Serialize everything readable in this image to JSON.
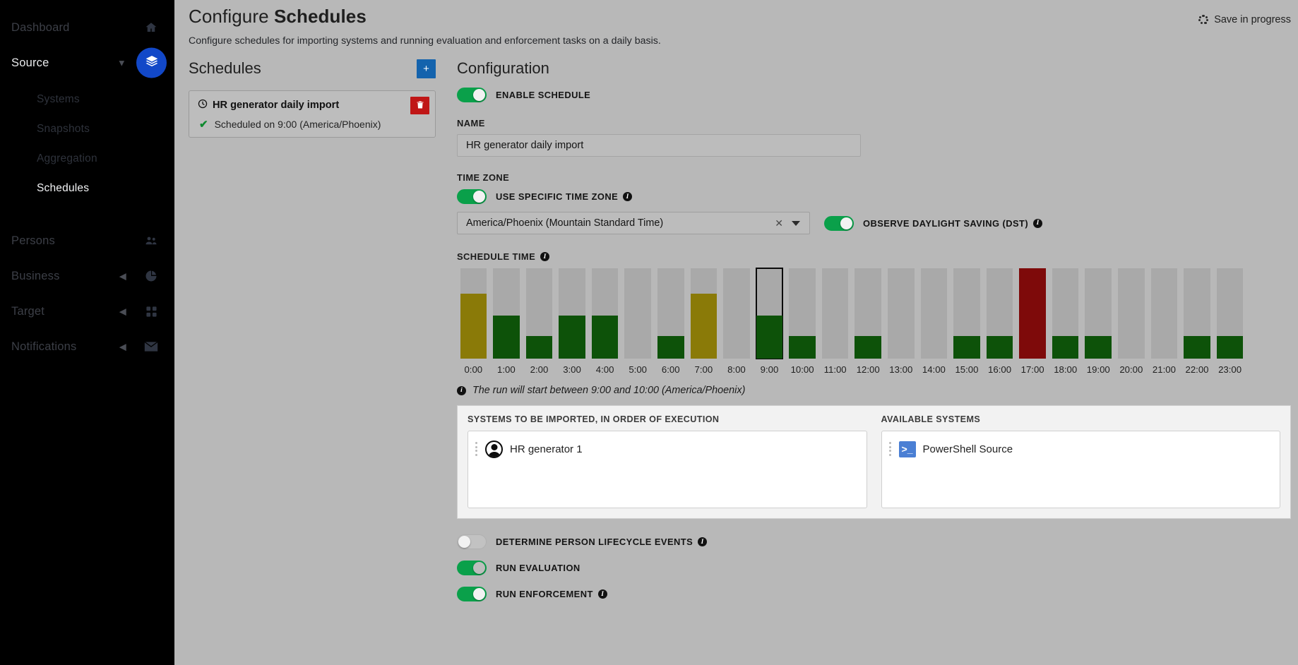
{
  "sidebar": {
    "items": [
      {
        "label": "Dashboard",
        "icon": "home-icon",
        "state": "dim",
        "chevron": false
      },
      {
        "label": "Source",
        "icon": "layers-icon",
        "state": "active",
        "chevron": true,
        "pill": true
      },
      {
        "label": "Persons",
        "icon": "people-icon",
        "state": "dim",
        "chevron": false
      },
      {
        "label": "Business",
        "icon": "pie-icon",
        "state": "dim",
        "chevron": true
      },
      {
        "label": "Target",
        "icon": "grid-icon",
        "state": "dim",
        "chevron": true
      },
      {
        "label": "Notifications",
        "icon": "envelope-icon",
        "state": "dim",
        "chevron": true
      }
    ],
    "subitems": [
      {
        "label": "Systems",
        "selected": false
      },
      {
        "label": "Snapshots",
        "selected": false
      },
      {
        "label": "Aggregation",
        "selected": false
      },
      {
        "label": "Schedules",
        "selected": true
      }
    ]
  },
  "header": {
    "title_prefix": "Configure ",
    "title_strong": "Schedules",
    "subtitle": "Configure schedules for importing systems and running evaluation and enforcement tasks on a daily basis.",
    "save_status": "Save in progress",
    "save_icon": "spinner-icon"
  },
  "schedules_panel": {
    "heading": "Schedules",
    "add_label": "+",
    "add_icon": "plus-icon",
    "items": [
      {
        "title": "HR generator daily import",
        "title_icon": "clock-icon",
        "status_icon": "check-icon",
        "status": "Scheduled on 9:00 (America/Phoenix)",
        "delete_icon": "trash-icon"
      }
    ]
  },
  "configuration": {
    "heading": "Configuration",
    "enable_schedule": {
      "label": "Enable schedule",
      "on": true
    },
    "name": {
      "label": "Name",
      "value": "HR generator daily import",
      "placeholder": "Name"
    },
    "time_zone": {
      "label": "Time zone",
      "use_specific": {
        "label": "Use specific time zone",
        "on": true,
        "info_icon": "info-icon"
      },
      "selected": "America/Phoenix (Mountain Standard Time)",
      "clear_icon": "clear-x-icon",
      "caret_icon": "chevron-down-icon",
      "dst": {
        "label": "Observe daylight saving (DST)",
        "on": true,
        "info_icon": "info-icon"
      }
    },
    "schedule_time": {
      "label": "Schedule time",
      "info_icon": "info-icon",
      "note": "The run will start between 9:00 and 10:00 (America/Phoenix)",
      "note_icon": "info-icon"
    },
    "systems": {
      "selected_caption": "Systems to be imported, in order of execution",
      "available_caption": "Available systems",
      "selected_items": [
        {
          "name": "HR generator 1",
          "icon": "person-avatar-icon"
        }
      ],
      "available_items": [
        {
          "name": "PowerShell Source",
          "icon": "powershell-icon"
        }
      ],
      "grip_icon": "drag-handle-icon"
    },
    "options": [
      {
        "label": "Determine person lifecycle events",
        "on": false,
        "info_icon": "info-icon",
        "name": "determine-person-lifecycle-events"
      },
      {
        "label": "Run evaluation",
        "on": true,
        "info_icon": null,
        "name": "run-evaluation"
      },
      {
        "label": "Run enforcement",
        "on": true,
        "info_icon": "info-icon",
        "name": "run-enforcement"
      }
    ]
  },
  "colors": {
    "track": "#a9a9a9",
    "green": "#0d5209",
    "olive": "#8a7a08",
    "red": "#7e0a0a",
    "accent_blue": "#1463ad",
    "toggle_on": "#0aa04a",
    "delete_red": "#c01616"
  },
  "chart_data": {
    "type": "bar",
    "title": "Schedule time",
    "xlabel": "",
    "ylabel": "",
    "ylim": [
      0,
      100
    ],
    "grid": false,
    "legend": null,
    "selected_category": "9:00",
    "categories": [
      "0:00",
      "1:00",
      "2:00",
      "3:00",
      "4:00",
      "5:00",
      "6:00",
      "7:00",
      "8:00",
      "9:00",
      "10:00",
      "11:00",
      "12:00",
      "13:00",
      "14:00",
      "15:00",
      "16:00",
      "17:00",
      "18:00",
      "19:00",
      "20:00",
      "21:00",
      "22:00",
      "23:00"
    ],
    "values": [
      72,
      48,
      25,
      48,
      48,
      0,
      25,
      72,
      0,
      48,
      25,
      0,
      25,
      0,
      0,
      25,
      25,
      100,
      25,
      25,
      0,
      0,
      25,
      25
    ],
    "bar_colors": [
      "#8a7a08",
      "#0d5209",
      "#0d5209",
      "#0d5209",
      "#0d5209",
      "#a9a9a9",
      "#0d5209",
      "#8a7a08",
      "#a9a9a9",
      "#0d5209",
      "#0d5209",
      "#a9a9a9",
      "#0d5209",
      "#a9a9a9",
      "#a9a9a9",
      "#0d5209",
      "#0d5209",
      "#7e0a0a",
      "#0d5209",
      "#0d5209",
      "#a9a9a9",
      "#a9a9a9",
      "#0d5209",
      "#0d5209"
    ]
  }
}
